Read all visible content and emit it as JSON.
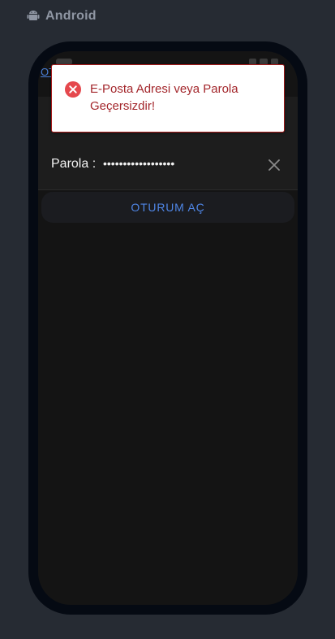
{
  "header": {
    "platform_label": "Android",
    "platform_icon": "android-icon"
  },
  "screen": {
    "back_link_label": "OT",
    "password_field": {
      "label": "Parola :",
      "masked_value": "••••••••••••••••••",
      "clear_icon": "close-icon"
    },
    "signin_button_label": "OTURUM AÇ"
  },
  "toast": {
    "icon": "error-circle-icon",
    "message": "E-Posta Adresi veya Parola Geçersizdir!",
    "text_color": "#a3262b",
    "border_color": "#a31a1a"
  },
  "colors": {
    "page_bg": "#262b33",
    "phone_frame": "#050a13",
    "screen_bg": "#141414",
    "accent": "#4f86e6"
  }
}
